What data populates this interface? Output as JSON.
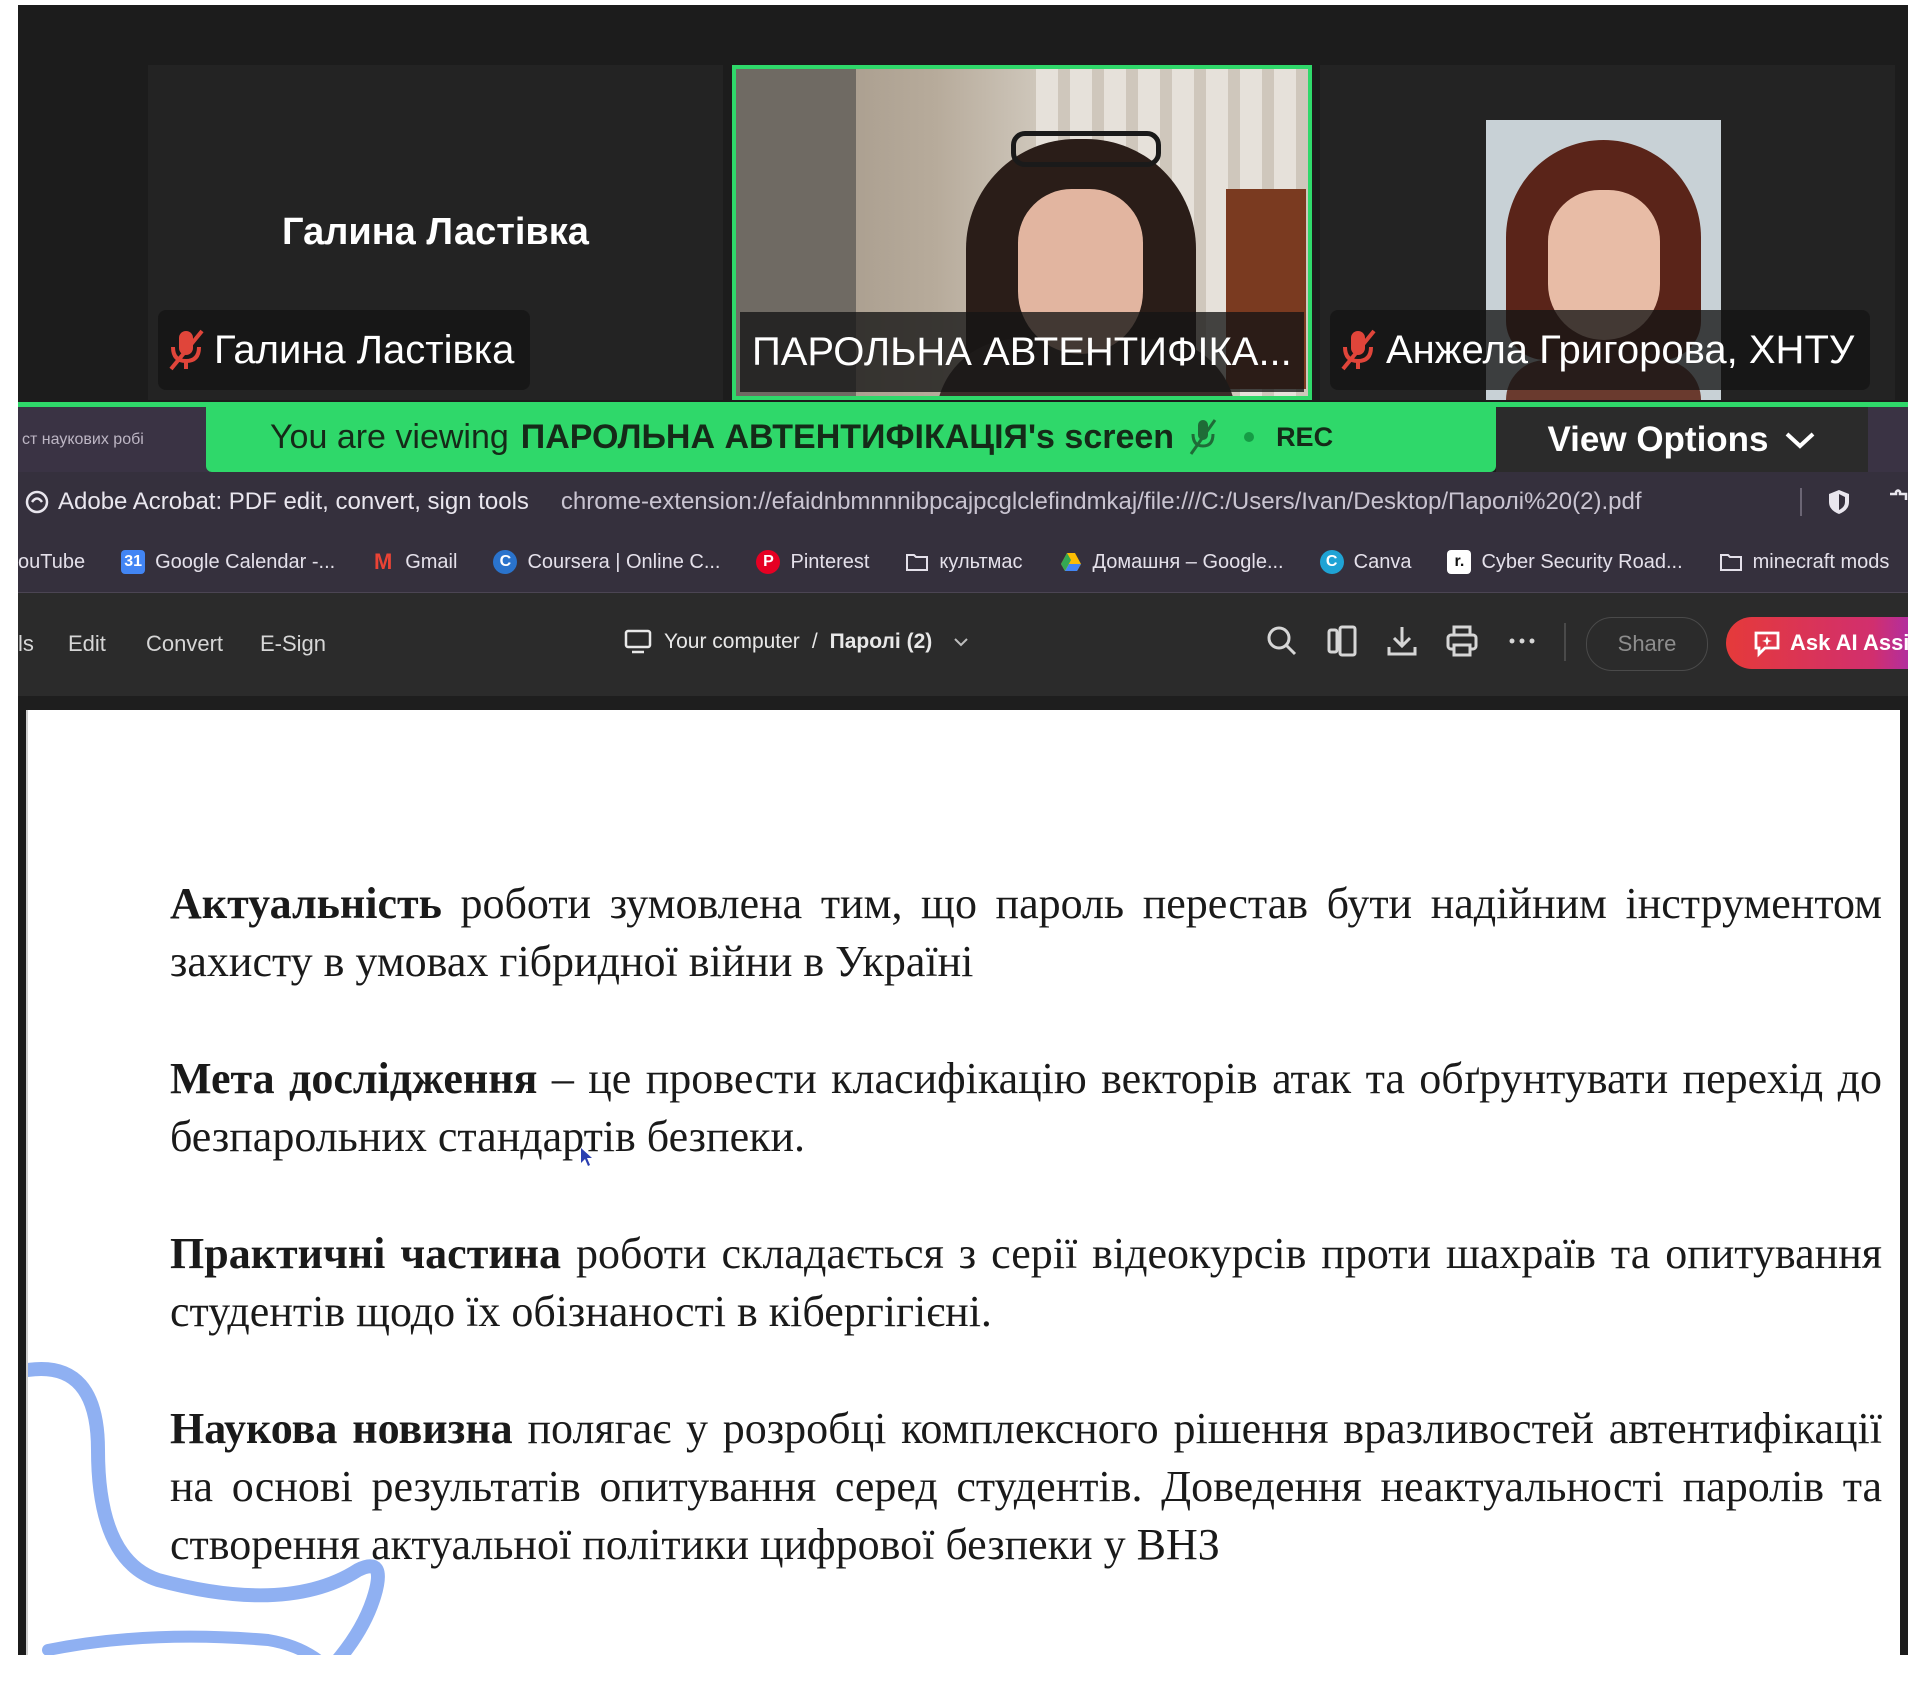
{
  "participants": [
    {
      "name_center": "Галина Ластівка",
      "label": "Галина Ластівка",
      "muted": true
    },
    {
      "label": "ПАРОЛЬНА АВТЕНТИФІКА...",
      "muted": false,
      "active_speaker": true
    },
    {
      "label": "Анжела Григорова, ХНТУ",
      "muted": true
    }
  ],
  "viewing_bar": {
    "left_tab_fragment": "ст наукових робі",
    "prefix": "You are viewing",
    "name": "ПАРОЛЬНА АВТЕНТИФІКАЦІЯ's screen",
    "rec": "REC",
    "view_options": "View Options"
  },
  "browser": {
    "site_label": "Adobe Acrobat: PDF edit, convert, sign tools",
    "url": "chrome-extension://efaidnbmnnnibpcajpcglclefindmkaj/file:///C:/Users/Ivan/Desktop/Паролі%20(2).pdf",
    "bookmarks": [
      {
        "label": "ouTube",
        "icon": "youtube-icon",
        "color": "#e0312b"
      },
      {
        "label": "Google Calendar -...",
        "icon": "calendar-icon",
        "color": "#4285f4"
      },
      {
        "label": "Gmail",
        "icon": "gmail-icon",
        "color": "#ea4335"
      },
      {
        "label": "Coursera | Online C...",
        "icon": "coursera-icon",
        "color": "#2a73cc"
      },
      {
        "label": "Pinterest",
        "icon": "pinterest-icon",
        "color": "#e60023"
      },
      {
        "label": "культмас",
        "icon": "folder-icon",
        "color": "#35303d"
      },
      {
        "label": "Домашня – Google...",
        "icon": "drive-icon",
        "color": "#fbbc04"
      },
      {
        "label": "Canva",
        "icon": "canva-icon",
        "color": "#1fa3d5"
      },
      {
        "label": "Cyber Security Road...",
        "icon": "roadmap-icon",
        "color": "#111111"
      },
      {
        "label": "minecraft mods",
        "icon": "folder-icon",
        "color": "#35303d"
      }
    ]
  },
  "acrobat": {
    "menu": [
      "ls",
      "Edit",
      "Convert",
      "E-Sign"
    ],
    "breadcrumb": {
      "location": "Your computer",
      "separator": "/",
      "file": "Паролі (2)"
    },
    "share": "Share",
    "ask_ai": "Ask AI Assi"
  },
  "document": {
    "paragraphs": [
      {
        "bold": "Актуальність",
        "text": " роботи зумовлена тим, що пароль перестав бути надійним інструментом захисту в умовах гібридної війни в Україні"
      },
      {
        "bold": "Мета дослідження",
        "text": " – це провести класифікацію векторів атак та обґрунтувати перехід до безпарольних стандартів безпеки."
      },
      {
        "bold": "Практичні частина",
        "text": " роботи складається з серії відеокурсів проти шахраїв та опитування студентів щодо їх обізнаності в кібергігієні."
      },
      {
        "bold": "Наукова новизна",
        "text": " полягає у розробці комплексного рішення вразливостей автентифікації на основі результатів опитування серед студентів. Доведення неактуальності паролів та створення актуальної політики цифрової безпеки у ВНЗ"
      }
    ]
  },
  "colors": {
    "accent_green": "#2fd86a",
    "muted_red": "#e0453a",
    "ai_button": "#e53a3a",
    "deco_stroke": "#8fb0f2"
  }
}
